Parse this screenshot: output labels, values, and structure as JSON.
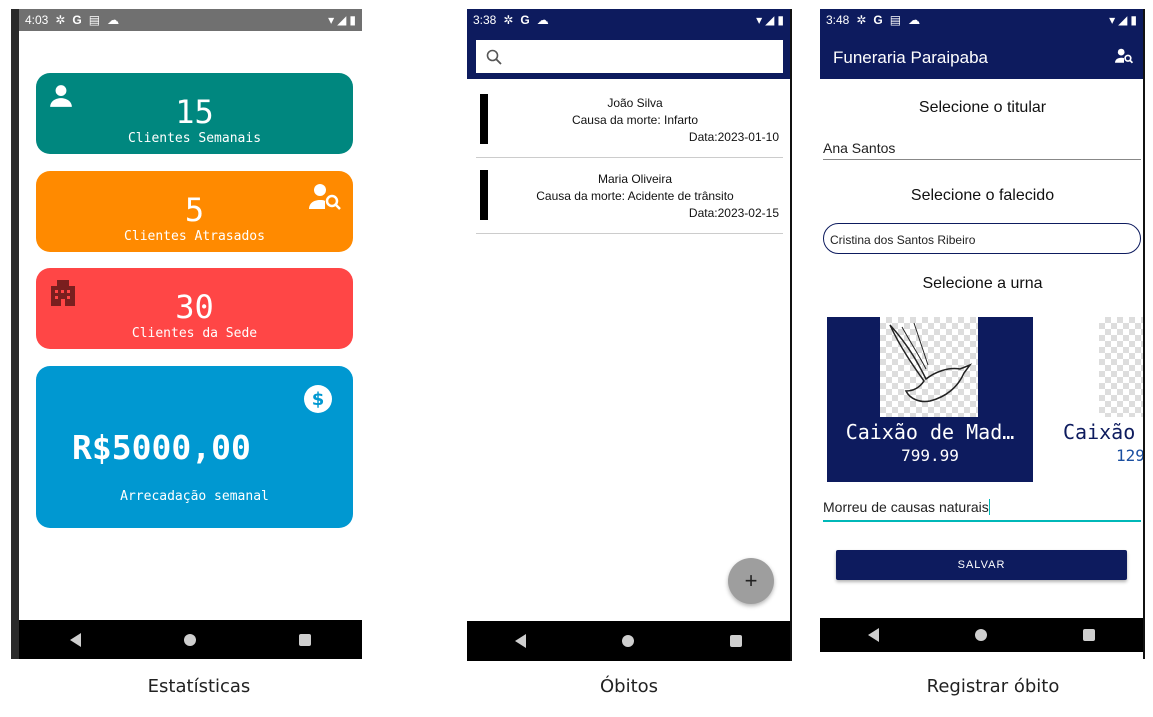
{
  "screen1": {
    "status_time": "4:03",
    "cards": [
      {
        "number": "15",
        "label": "Clientes Semanais",
        "color": "#00877f",
        "icon": "person-icon"
      },
      {
        "number": "5",
        "label": "Clientes Atrasados",
        "color": "#ff8a00",
        "icon": "person-search-icon"
      },
      {
        "number": "30",
        "label": "Clientes da Sede",
        "color": "#ff4646",
        "icon": "building-icon"
      },
      {
        "number": "R$5000,00",
        "label": "Arrecadação semanal",
        "color": "#0098d1",
        "icon": "dollar-icon"
      }
    ],
    "caption": "Estatísticas"
  },
  "screen2": {
    "status_time": "3:38",
    "search": {
      "placeholder": ""
    },
    "obitos": [
      {
        "name": "João Silva",
        "cause": "Causa da morte: Infarto",
        "date": "Data:2023-01-10"
      },
      {
        "name": "Maria Oliveira",
        "cause": "Causa da morte: Acidente de trânsito",
        "date": "Data:2023-02-15"
      }
    ],
    "fab_label": "+",
    "caption": "Óbitos"
  },
  "screen3": {
    "status_time": "3:48",
    "app_title": "Funeraria Paraipaba",
    "titular_label": "Selecione o titular",
    "titular_value": "Ana Santos",
    "falecido_label": "Selecione o falecido",
    "falecido_value": "Cristina dos Santos Ribeiro",
    "urna_label": "Selecione a urna",
    "urnas": [
      {
        "name": "Caixão de Mad…",
        "price": "799.99"
      },
      {
        "name": "Caixão",
        "price": "129"
      }
    ],
    "observacao_value": "Morreu de causas naturais",
    "save_label": "SALVAR",
    "caption": "Registrar óbito"
  },
  "colors": {
    "navy": "#0d1b5e",
    "accent_teal": "#00b8b8"
  }
}
